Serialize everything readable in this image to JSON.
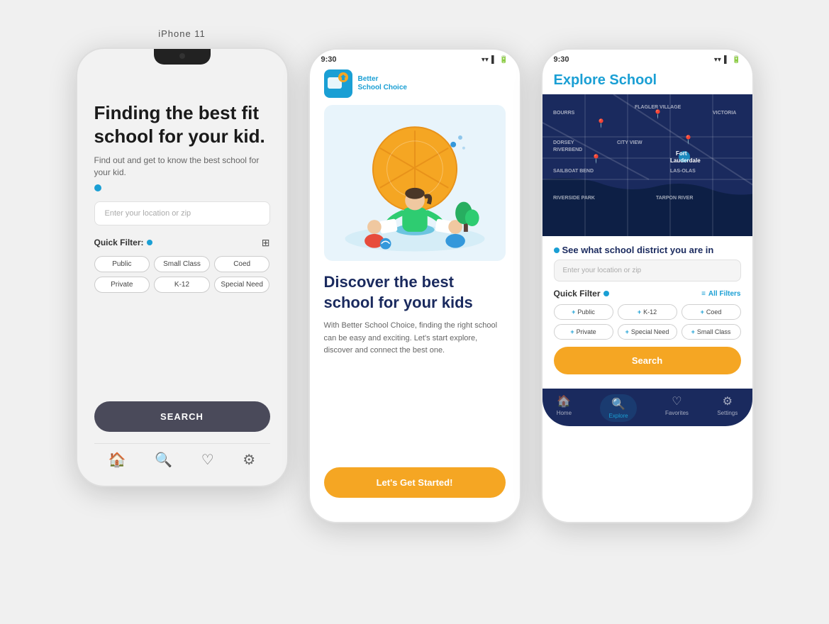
{
  "page": {
    "bg": "#f0f0f0"
  },
  "phone1": {
    "label": "iPhone 11",
    "heading": "Finding the best fit school for your kid.",
    "subheading": "Find out and get to know the best school for your kid.",
    "input_placeholder": "Enter your location or zip",
    "quick_filter_label": "Quick Filter:",
    "chips": [
      "Public",
      "Small Class",
      "Coed",
      "Private",
      "K-12",
      "Special Need"
    ],
    "search_btn": "SEARCH",
    "nav_icons": [
      "🏠",
      "🔍",
      "♡",
      "⚙"
    ]
  },
  "phone2": {
    "status_time": "9:30",
    "logo_text": "Better\nSchool Choice",
    "discover_heading": "Discover the best school for your kids",
    "desc": "With Better School Choice, finding the right school can be easy and exciting. Let's start explore, discover and connect the best one.",
    "cta_label": "Let's Get Started!"
  },
  "phone3": {
    "status_time": "9:30",
    "title": "Explore School",
    "map_labels": [
      "BOURRS",
      "FLAGLER VILLAGE",
      "VICTORIA",
      "DORSEY RIVERBEND",
      "CITY VIEW",
      "Fort Lauderdale",
      "SAILBOAT BEND",
      "LAS-OLAS",
      "RIVERSIDE PARK",
      "TARPON RIVER"
    ],
    "section_label": "See what school district you are in",
    "input_placeholder": "Enter your location or zip",
    "quick_filter_label": "Quick Filter",
    "all_filters": "All Filters",
    "chips": [
      "Public",
      "K-12",
      "Coed",
      "Private",
      "Special Need",
      "Small Class"
    ],
    "search_btn": "Search",
    "nav": [
      {
        "icon": "🏠",
        "label": "Home",
        "active": false
      },
      {
        "icon": "🔍",
        "label": "Explore",
        "active": true
      },
      {
        "icon": "♡",
        "label": "Favorites",
        "active": false
      },
      {
        "icon": "⚙",
        "label": "Settings",
        "active": false
      }
    ]
  }
}
